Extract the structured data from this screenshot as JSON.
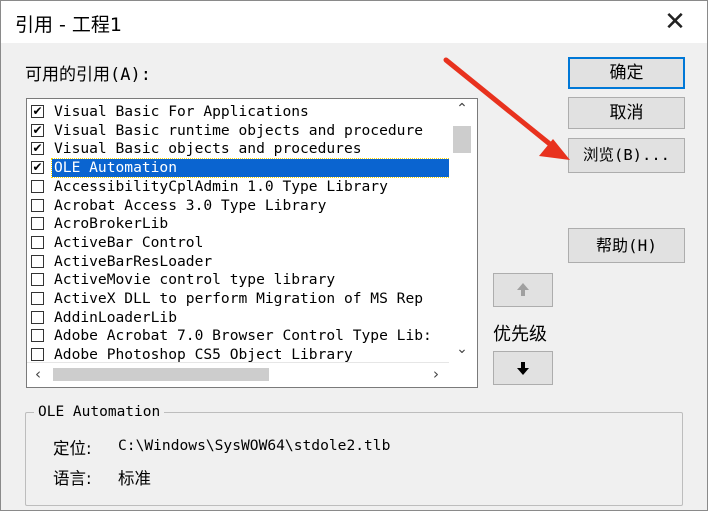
{
  "window": {
    "title": "引用 - 工程1",
    "close_glyph": "✕"
  },
  "available_label": "可用的引用(A):",
  "references": [
    {
      "label": "Visual Basic For Applications",
      "checked": true,
      "selected": false
    },
    {
      "label": "Visual Basic runtime objects and procedure",
      "checked": true,
      "selected": false
    },
    {
      "label": "Visual Basic objects and procedures",
      "checked": true,
      "selected": false
    },
    {
      "label": "OLE Automation",
      "checked": true,
      "selected": true
    },
    {
      "label": "AccessibilityCplAdmin 1.0 Type Library",
      "checked": false,
      "selected": false
    },
    {
      "label": "Acrobat Access 3.0 Type Library",
      "checked": false,
      "selected": false
    },
    {
      "label": "AcroBrokerLib",
      "checked": false,
      "selected": false
    },
    {
      "label": "ActiveBar Control",
      "checked": false,
      "selected": false
    },
    {
      "label": "ActiveBarResLoader",
      "checked": false,
      "selected": false
    },
    {
      "label": "ActiveMovie control type library",
      "checked": false,
      "selected": false
    },
    {
      "label": "ActiveX DLL to perform Migration of MS Rep",
      "checked": false,
      "selected": false
    },
    {
      "label": "AddinLoaderLib",
      "checked": false,
      "selected": false
    },
    {
      "label": "Adobe Acrobat 7.0 Browser Control Type Lib:",
      "checked": false,
      "selected": false
    },
    {
      "label": "Adobe Photoshop CS5 Object Library",
      "checked": false,
      "selected": false
    }
  ],
  "buttons": {
    "ok": "确定",
    "cancel": "取消",
    "browse": "浏览(B)...",
    "help": "帮助(H)"
  },
  "priority": {
    "label": "优先级",
    "up_icon": "up-arrow-icon",
    "down_icon": "down-arrow-icon"
  },
  "details": {
    "group_caption": "OLE Automation",
    "location_label": "定位:",
    "location_value": "C:\\Windows\\SysWOW64\\stdole2.tlb",
    "language_label": "语言:",
    "language_value": "标准"
  },
  "colors": {
    "selection": "#0a64d0",
    "annotation_arrow": "#e8321e",
    "default_button_border": "#0078d7"
  }
}
